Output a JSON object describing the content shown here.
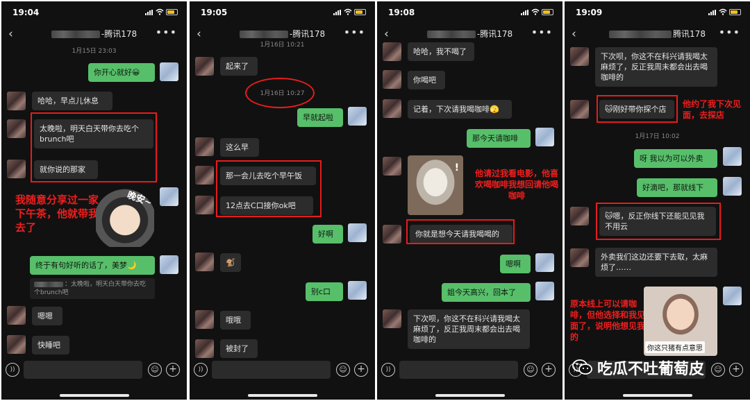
{
  "phone1": {
    "time": "19:04",
    "title_suffix": "-腾讯178",
    "timestamp": "1月15日 23:03",
    "msg1": "你开心就好😀",
    "msg2": "哈哈，早点儿休息",
    "msg3": "太晚啦，明天白天带你去吃个brunch吧",
    "msg4": "就你说的那家",
    "sticker_text": "晚安~",
    "msg5": "终于有句好听的话了，美梦🌙",
    "quote": "：太晚啦，明天白天带你去吃个brunch吧",
    "msg6": "嗯嗯",
    "msg7": "快睡吧",
    "annotation": "我随意分享过一家下午茶，他就带我去了"
  },
  "phone2": {
    "time": "19:05",
    "title_suffix": "-腾讯178",
    "timestamp": "1月16日 10:21",
    "msg1": "起来了",
    "timestamp2": "1月16日 10:27",
    "msg2": "早就起啦",
    "msg3": "这么早",
    "msg4": "那一会儿去吃个早午饭",
    "msg5": "12点去C口接你ok吧",
    "msg6": "好啊",
    "msg7": "🐒",
    "msg8": "别c口",
    "msg9": "哦哦",
    "msg10": "被封了"
  },
  "phone3": {
    "time": "19:08",
    "title_suffix": "-腾讯178",
    "msg1": "哈哈，我不喝了",
    "msg2": "你喝吧",
    "msg3": "记着，下次请我喝咖啡🫣",
    "msg4": "那今天请咖啡",
    "msg5": "你就是想今天请我喝喝的",
    "msg6": "嗯啊",
    "msg7": "姐今天高兴，回本了",
    "msg8": "下次呗，你这不在科兴请我喝太麻烦了，反正我周末都会出去喝咖啡的",
    "annotation": "他请过我看电影，他喜欢喝咖啡我想回请他喝咖啡"
  },
  "phone4": {
    "time": "19:09",
    "title_suffix": "腾讯178",
    "msg1": "下次呗，你这不在科兴请我喝太麻烦了，反正我周末都会出去喝咖啡的",
    "msg2": "🐱刚好带你探个店",
    "timestamp": "1月17日 10:02",
    "msg3": "呀 我以为可以外卖",
    "msg4": "好滴吧，那就线下",
    "msg5": "🐱嗯，反正你线下还能见见我不用云",
    "msg6": "外卖我们这边还要下去取，太麻烦了……",
    "sticker_caption": "你这只猪有点意思",
    "annotation1": "他约了我下次见面，去探店",
    "annotation2": "原本线上可以请咖啡，但他选择和我见面了，说明他想见我的"
  },
  "watermark": "吃瓜不吐葡萄皮",
  "colors": {
    "accent_red": "#e81c1c",
    "bubble_green": "#57bf6a",
    "bg_dark": "#111111"
  }
}
